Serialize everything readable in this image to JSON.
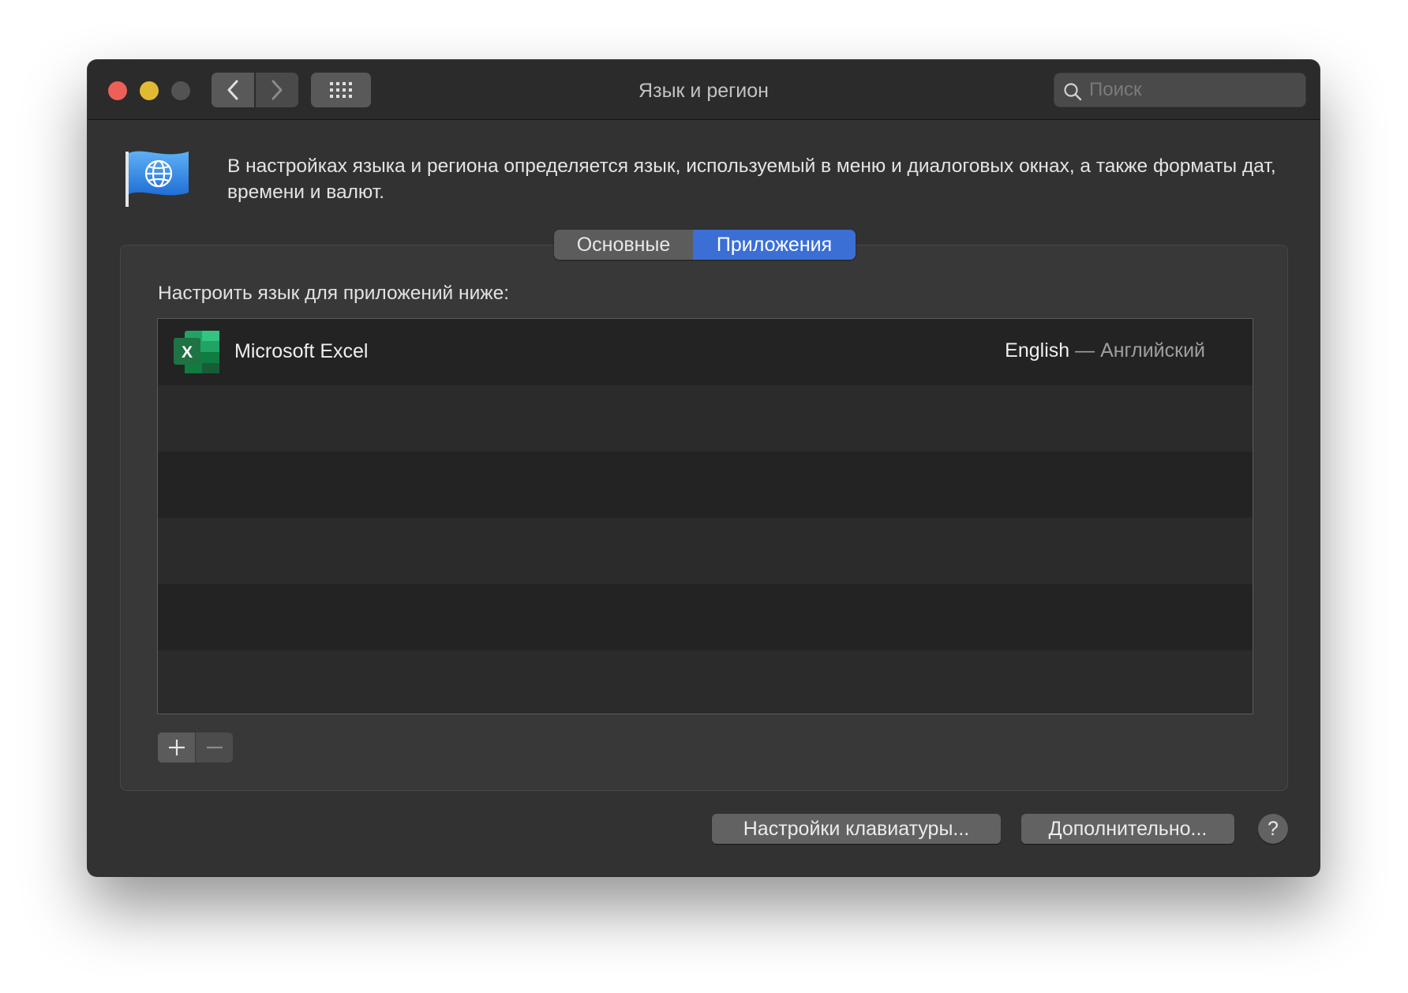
{
  "window": {
    "title": "Язык и регион",
    "search": {
      "placeholder": "Поиск",
      "value": ""
    },
    "nav": {
      "back_icon": "chevron-left-icon",
      "forward_icon": "chevron-right-icon",
      "grid_icon": "grid-icon"
    }
  },
  "header": {
    "icon": "globe-flag-icon",
    "description": "В настройках языка и региона определяется язык, используемый в меню и диалоговых окнах, а также форматы дат, времени и валют."
  },
  "tabs": [
    {
      "label": "Основные",
      "selected": false
    },
    {
      "label": "Приложения",
      "selected": true
    }
  ],
  "apps_panel": {
    "label": "Настроить язык для приложений ниже:",
    "rows": [
      {
        "icon": "excel-icon",
        "name": "Microsoft Excel",
        "language": "English",
        "separator": " — ",
        "language_local": "Английский"
      }
    ],
    "add_icon": "plus-icon",
    "remove_icon": "minus-icon"
  },
  "footer": {
    "keyboard_button": "Настройки клавиатуры...",
    "advanced_button": "Дополнительно...",
    "help_button": "?"
  },
  "colors": {
    "accent": "#3b6fd6",
    "close": "#ed5f57",
    "minimize": "#e2b932",
    "excel_green": "#1f7244"
  }
}
